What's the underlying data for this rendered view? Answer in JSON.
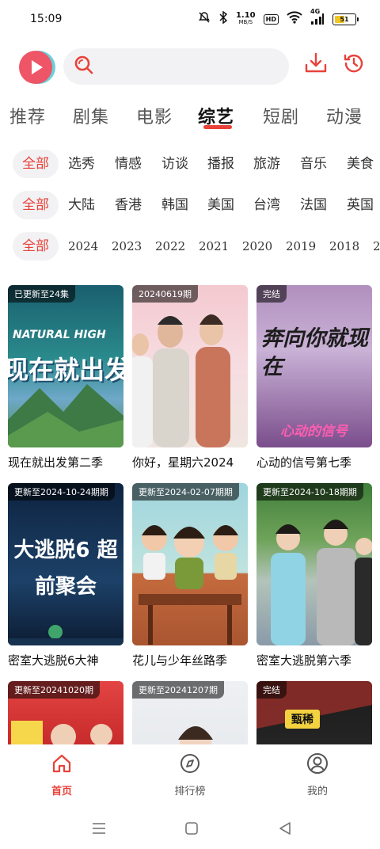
{
  "status_bar": {
    "time": "15:09",
    "speed_value": "1.10",
    "speed_unit": "MB/S",
    "hd": "HD",
    "network": "4G",
    "battery": "51",
    "battery_level": 0.51
  },
  "header": {
    "search_placeholder": "",
    "icons": [
      "app-logo",
      "search-icon",
      "download-icon",
      "history-icon"
    ]
  },
  "tabs": {
    "items": [
      "推荐",
      "剧集",
      "电影",
      "综艺",
      "短剧",
      "动漫"
    ],
    "active": "综艺"
  },
  "filters": {
    "type": [
      "全部",
      "选秀",
      "情感",
      "访谈",
      "播报",
      "旅游",
      "音乐",
      "美食"
    ],
    "region": [
      "全部",
      "大陆",
      "香港",
      "韩国",
      "美国",
      "台湾",
      "法国",
      "英国"
    ],
    "year": [
      "全部",
      "2024",
      "2023",
      "2022",
      "2021",
      "2020",
      "2019",
      "2018",
      "2"
    ]
  },
  "cards": [
    {
      "title": "现在就出发第二季",
      "badge": "已更新至24集",
      "poster_text": "现在就出发",
      "poster_logo": "NATURAL HIGH"
    },
    {
      "title": "你好，星期六2024",
      "badge": "20240619期",
      "poster_text": "",
      "poster_logo": ""
    },
    {
      "title": "心动的信号第七季",
      "badge": "完结",
      "poster_text": "奔向你就现在",
      "poster_logo": "心动的信号"
    },
    {
      "title": "密室大逃脱6大神",
      "badge": "更新至2024-10-24期期",
      "poster_text": "大逃脱6 超前聚会",
      "poster_logo": ""
    },
    {
      "title": "花儿与少年丝路季",
      "badge": "更新至2024-02-07期期",
      "poster_text": "",
      "poster_logo": ""
    },
    {
      "title": "密室大逃脱第六季",
      "badge": "更新至2024-10-18期期",
      "poster_text": "",
      "poster_logo": ""
    },
    {
      "title": "",
      "badge": "更新至20241020期",
      "poster_text": "",
      "poster_logo": ""
    },
    {
      "title": "",
      "badge": "更新至20241207期",
      "poster_text": "",
      "poster_logo": ""
    },
    {
      "title": "",
      "badge": "完结",
      "poster_text": "",
      "poster_logo": "甄稀"
    }
  ],
  "bottom_nav": {
    "items": [
      {
        "label": "首页",
        "icon": "home-icon",
        "active": true
      },
      {
        "label": "排行榜",
        "icon": "compass-icon",
        "active": false
      },
      {
        "label": "我的",
        "icon": "profile-icon",
        "active": false
      }
    ]
  },
  "colors": {
    "accent": "#e8423a",
    "chip_bg": "#f2f2f4"
  }
}
